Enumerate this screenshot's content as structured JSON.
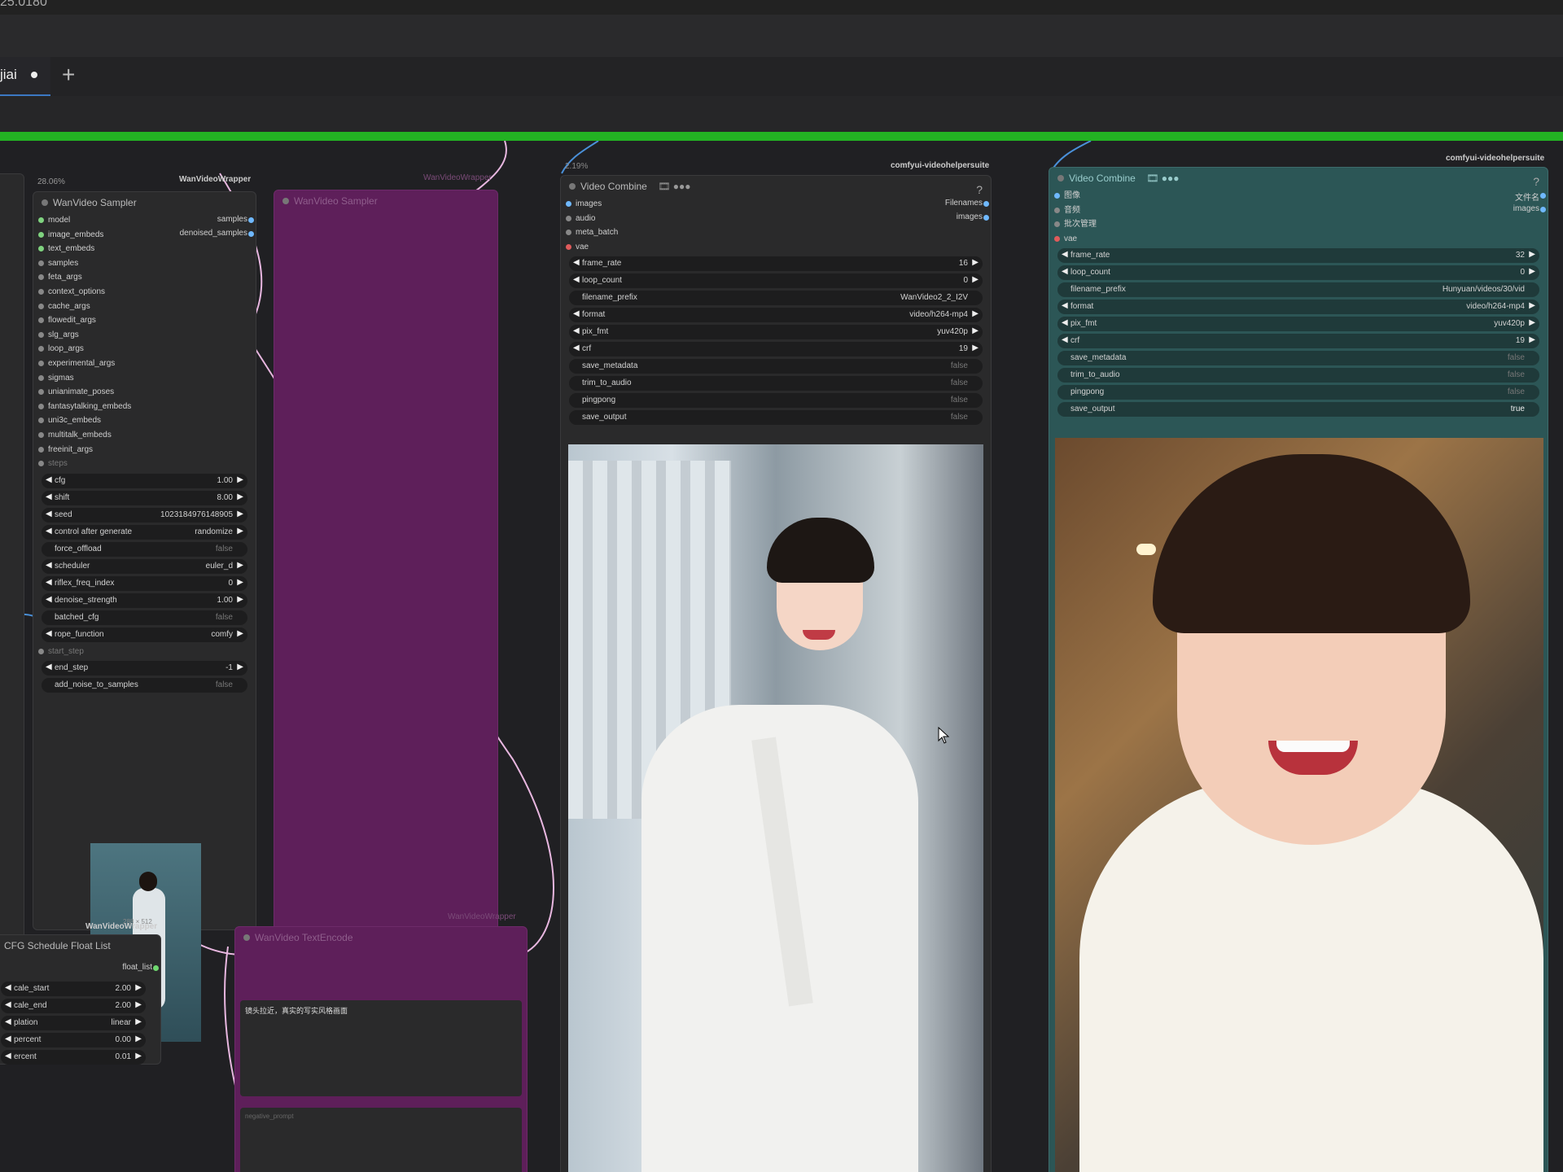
{
  "app": {
    "version_text": "25.0180"
  },
  "tabs": [
    {
      "label": "jiai",
      "modified": true
    }
  ],
  "tab_add_label": "+",
  "progress_percent": 100,
  "nodes": {
    "sampler": {
      "source": "WanVideoWrapper",
      "percent": "28.06%",
      "title": "WanVideo Sampler",
      "inputs": [
        "model",
        "image_embeds",
        "text_embeds",
        "samples",
        "feta_args",
        "context_options",
        "cache_args",
        "flowedit_args",
        "slg_args",
        "loop_args",
        "experimental_args",
        "sigmas",
        "unianimate_poses",
        "fantasytalking_embeds",
        "uni3c_embeds",
        "multitalk_embeds",
        "freeinit_args"
      ],
      "outputs": [
        "samples",
        "denoised_samples"
      ],
      "steps_label": "steps",
      "widgets": [
        {
          "label": "cfg",
          "value": "1.00",
          "type": "num"
        },
        {
          "label": "shift",
          "value": "8.00",
          "type": "num"
        },
        {
          "label": "seed",
          "value": "1023184976148905",
          "type": "num"
        },
        {
          "label": "control after generate",
          "value": "randomize",
          "type": "num"
        },
        {
          "label": "force_offload",
          "value": "false",
          "type": "toggle"
        },
        {
          "label": "scheduler",
          "value": "euler_d",
          "type": "num"
        },
        {
          "label": "riflex_freq_index",
          "value": "0",
          "type": "num"
        },
        {
          "label": "denoise_strength",
          "value": "1.00",
          "type": "num"
        },
        {
          "label": "batched_cfg",
          "value": "false",
          "type": "toggle"
        },
        {
          "label": "rope_function",
          "value": "comfy",
          "type": "num"
        }
      ],
      "start_step_label": "start_step",
      "widgets2": [
        {
          "label": "end_step",
          "value": "-1",
          "type": "num"
        },
        {
          "label": "add_noise_to_samples",
          "value": "false",
          "type": "toggle"
        }
      ],
      "preview_caption": "288 × 512"
    },
    "cfg_schedule": {
      "source": "WanVideoWrapper",
      "title": "CFG Schedule Float List",
      "output": "float_list",
      "widgets": [
        {
          "label": "cale_start",
          "value": "2.00"
        },
        {
          "label": "cale_end",
          "value": "2.00"
        },
        {
          "label": "plation",
          "value": "linear"
        },
        {
          "label": "percent",
          "value": "0.00"
        },
        {
          "label": "ercent",
          "value": "0.01"
        }
      ]
    },
    "text_encode": {
      "source": "WanVideoWrapper",
      "title": "WanVideo TextEncode",
      "prompt_text": "镜头拉近，真实的写实风格画面",
      "negative_label": "negative_prompt"
    },
    "vc1": {
      "source": "comfyui-videohelpersuite",
      "percent": "2.19%",
      "title": "Video Combine",
      "title_suffix": "🎞 ●●●",
      "help": "?",
      "inputs": [
        "images",
        "audio",
        "meta_batch",
        "vae"
      ],
      "outputs": [
        "Filenames",
        "images"
      ],
      "widgets": [
        {
          "label": "frame_rate",
          "value": "16",
          "type": "num"
        },
        {
          "label": "loop_count",
          "value": "0",
          "type": "num"
        },
        {
          "label": "filename_prefix",
          "value": "WanVideo2_2_I2V",
          "type": "text"
        },
        {
          "label": "format",
          "value": "video/h264-mp4",
          "type": "num"
        },
        {
          "label": "pix_fmt",
          "value": "yuv420p",
          "type": "num"
        },
        {
          "label": "crf",
          "value": "19",
          "type": "num"
        },
        {
          "label": "save_metadata",
          "value": "false",
          "type": "toggle"
        },
        {
          "label": "trim_to_audio",
          "value": "false",
          "type": "toggle"
        },
        {
          "label": "pingpong",
          "value": "false",
          "type": "toggle"
        },
        {
          "label": "save_output",
          "value": "false",
          "type": "toggle"
        }
      ]
    },
    "vc2": {
      "source": "comfyui-videohelpersuite",
      "title": "Video Combine",
      "title_suffix": "🎞 ●●●",
      "help": "?",
      "inputs": [
        "图像",
        "音频",
        "批次管理",
        "vae"
      ],
      "outputs": [
        "文件名",
        "images"
      ],
      "widgets": [
        {
          "label": "frame_rate",
          "value": "32",
          "type": "num"
        },
        {
          "label": "loop_count",
          "value": "0",
          "type": "num"
        },
        {
          "label": "filename_prefix",
          "value": "Hunyuan/videos/30/vid",
          "type": "text"
        },
        {
          "label": "format",
          "value": "video/h264-mp4",
          "type": "num"
        },
        {
          "label": "pix_fmt",
          "value": "yuv420p",
          "type": "num"
        },
        {
          "label": "crf",
          "value": "19",
          "type": "num"
        },
        {
          "label": "save_metadata",
          "value": "false",
          "type": "toggle"
        },
        {
          "label": "trim_to_audio",
          "value": "false",
          "type": "toggle"
        },
        {
          "label": "pingpong",
          "value": "false",
          "type": "toggle"
        },
        {
          "label": "save_output",
          "value": "true",
          "type": "toggle"
        }
      ]
    }
  },
  "colors": {
    "accent_green": "#23b223",
    "bypassed_node": "#5e1f5a",
    "selected_node": "#2c5656",
    "link": "#e8b7e0"
  }
}
